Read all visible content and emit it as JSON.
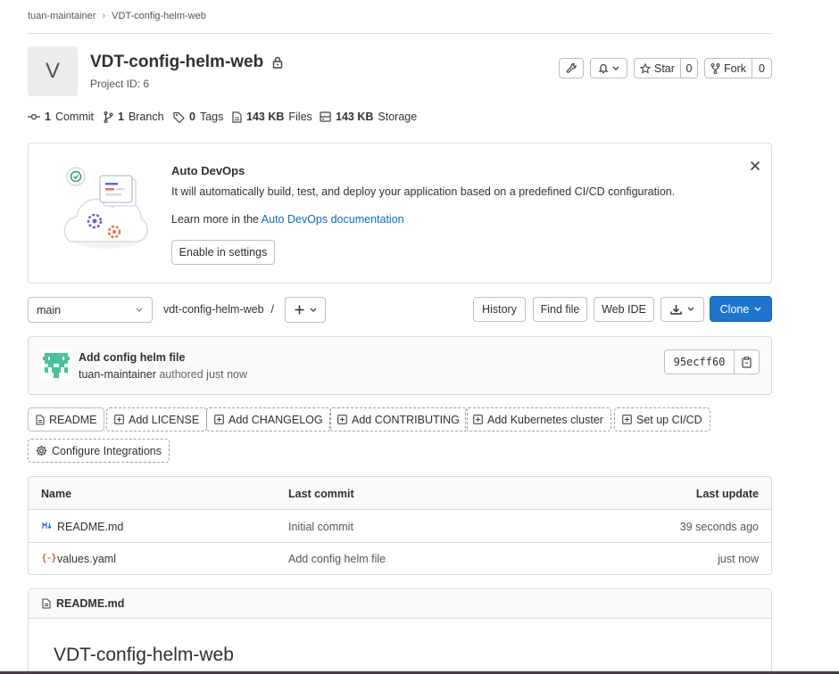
{
  "breadcrumb": {
    "parent": "tuan-maintainer",
    "separator": "›",
    "current": "VDT-config-helm-web"
  },
  "project": {
    "avatar_letter": "V",
    "name": "VDT-config-helm-web",
    "id_label": "Project ID: 6"
  },
  "actions": {
    "star_label": "Star",
    "star_count": "0",
    "fork_label": "Fork",
    "fork_count": "0"
  },
  "stats": [
    {
      "value": "1",
      "label": "Commit",
      "icon": "commit-icon"
    },
    {
      "value": "1",
      "label": "Branch",
      "icon": "branch-icon"
    },
    {
      "value": "0",
      "label": "Tags",
      "icon": "tag-icon"
    },
    {
      "value": "143 KB",
      "label": "Files",
      "icon": "file-icon"
    },
    {
      "value": "143 KB",
      "label": "Storage",
      "icon": "storage-icon"
    }
  ],
  "devops": {
    "title": "Auto DevOps",
    "description": "It will automatically build, test, and deploy your application based on a predefined CI/CD configuration.",
    "learn_prefix": "Learn more in the",
    "learn_link": "Auto DevOps documentation",
    "enable_button": "Enable in settings"
  },
  "repo_toolbar": {
    "branch": "main",
    "path": "vdt-config-helm-web",
    "path_sep": "/",
    "history": "History",
    "find_file": "Find file",
    "web_ide": "Web IDE",
    "clone": "Clone"
  },
  "last_commit": {
    "message": "Add config helm file",
    "author": "tuan-maintainer",
    "authored": "authored just now",
    "sha": "95ecff60"
  },
  "quick_links": [
    "README",
    "Add LICENSE",
    "Add CHANGELOG",
    "Add CONTRIBUTING",
    "Add Kubernetes cluster",
    "Set up CI/CD",
    "Configure Integrations"
  ],
  "file_table": {
    "headers": {
      "name": "Name",
      "last_commit": "Last commit",
      "last_update": "Last update"
    },
    "rows": [
      {
        "name": "README.md",
        "commit": "Initial commit",
        "updated": "39 seconds ago",
        "icon": "markdown-icon"
      },
      {
        "name": "values.yaml",
        "commit": "Add config helm file",
        "updated": "just now",
        "icon": "yaml-icon"
      }
    ]
  },
  "readme": {
    "filename": "README.md",
    "heading": "VDT-config-helm-web"
  },
  "colors": {
    "accent": "#1f75cb",
    "link": "#1068bf",
    "border": "#dbdbdb"
  }
}
